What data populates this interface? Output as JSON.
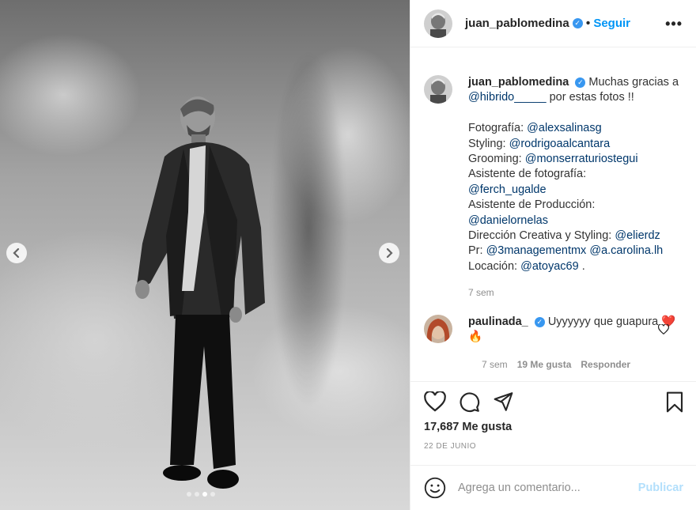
{
  "post": {
    "author": "juan_pablomedina",
    "follow_label": "Seguir",
    "more_label": "•••",
    "separator": "•"
  },
  "caption": {
    "author": "juan_pablomedina",
    "text_lead": "Muchas gracias a ",
    "mention_hibrido": "@hibrido_____",
    "text_tail": " por estas fotos !!",
    "lines": [
      {
        "label": "Fotografía: ",
        "mention": "@alexsalinasg"
      },
      {
        "label": "Styling: ",
        "mention": "@rodrigoaalcantara"
      },
      {
        "label": "Grooming: ",
        "mention": "@monserraturiostegui"
      },
      {
        "label": "Asistente de fotografía:",
        "mention": ""
      },
      {
        "label": "",
        "mention": "@ferch_ugalde"
      },
      {
        "label": "Asistente de Producción:",
        "mention": ""
      },
      {
        "label": "",
        "mention": "@danielornelas"
      },
      {
        "label": "Dirección Creativa y Styling: ",
        "mention": "@elierdz"
      },
      {
        "label": "Pr: ",
        "mention": "@3managementmx",
        "mention2": "@a.carolina.lh"
      },
      {
        "label": "Locación: ",
        "mention": "@atoyac69",
        "suffix": " ."
      }
    ],
    "time": "7 sem"
  },
  "comment": {
    "author": "paulinada_",
    "text": "Uyyyyyy que guapura",
    "emoji": "❤️🔥",
    "time": "7 sem",
    "likes": "19 Me gusta",
    "reply": "Responder"
  },
  "stats": {
    "likes": "17,687 Me gusta",
    "date": "22 DE JUNIO"
  },
  "composer": {
    "placeholder": "Agrega un comentario...",
    "publish": "Publicar"
  },
  "carousel": {
    "slide_count": 4,
    "active_index": 2
  },
  "colors": {
    "link": "#00376b",
    "follow": "#0095f6",
    "verified": "#3897f0",
    "muted": "#8e8e8e",
    "publish_disabled": "#b2dffc"
  }
}
